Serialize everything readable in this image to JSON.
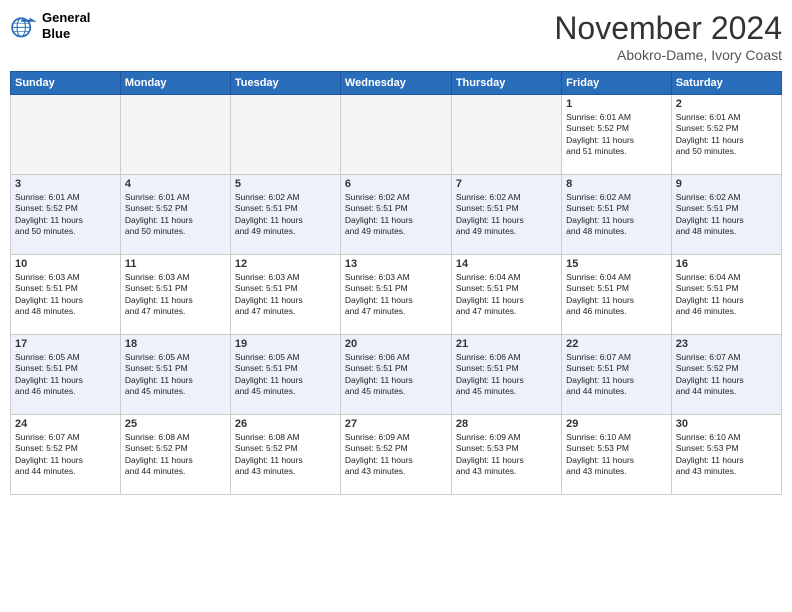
{
  "header": {
    "logo": {
      "line1": "General",
      "line2": "Blue"
    },
    "title": "November 2024",
    "location": "Abokro-Dame, Ivory Coast"
  },
  "weekdays": [
    "Sunday",
    "Monday",
    "Tuesday",
    "Wednesday",
    "Thursday",
    "Friday",
    "Saturday"
  ],
  "weeks": [
    [
      {
        "day": null,
        "info": ""
      },
      {
        "day": null,
        "info": ""
      },
      {
        "day": null,
        "info": ""
      },
      {
        "day": null,
        "info": ""
      },
      {
        "day": null,
        "info": ""
      },
      {
        "day": 1,
        "info": "Sunrise: 6:01 AM\nSunset: 5:52 PM\nDaylight: 11 hours\nand 51 minutes."
      },
      {
        "day": 2,
        "info": "Sunrise: 6:01 AM\nSunset: 5:52 PM\nDaylight: 11 hours\nand 50 minutes."
      }
    ],
    [
      {
        "day": 3,
        "info": "Sunrise: 6:01 AM\nSunset: 5:52 PM\nDaylight: 11 hours\nand 50 minutes."
      },
      {
        "day": 4,
        "info": "Sunrise: 6:01 AM\nSunset: 5:52 PM\nDaylight: 11 hours\nand 50 minutes."
      },
      {
        "day": 5,
        "info": "Sunrise: 6:02 AM\nSunset: 5:51 PM\nDaylight: 11 hours\nand 49 minutes."
      },
      {
        "day": 6,
        "info": "Sunrise: 6:02 AM\nSunset: 5:51 PM\nDaylight: 11 hours\nand 49 minutes."
      },
      {
        "day": 7,
        "info": "Sunrise: 6:02 AM\nSunset: 5:51 PM\nDaylight: 11 hours\nand 49 minutes."
      },
      {
        "day": 8,
        "info": "Sunrise: 6:02 AM\nSunset: 5:51 PM\nDaylight: 11 hours\nand 48 minutes."
      },
      {
        "day": 9,
        "info": "Sunrise: 6:02 AM\nSunset: 5:51 PM\nDaylight: 11 hours\nand 48 minutes."
      }
    ],
    [
      {
        "day": 10,
        "info": "Sunrise: 6:03 AM\nSunset: 5:51 PM\nDaylight: 11 hours\nand 48 minutes."
      },
      {
        "day": 11,
        "info": "Sunrise: 6:03 AM\nSunset: 5:51 PM\nDaylight: 11 hours\nand 47 minutes."
      },
      {
        "day": 12,
        "info": "Sunrise: 6:03 AM\nSunset: 5:51 PM\nDaylight: 11 hours\nand 47 minutes."
      },
      {
        "day": 13,
        "info": "Sunrise: 6:03 AM\nSunset: 5:51 PM\nDaylight: 11 hours\nand 47 minutes."
      },
      {
        "day": 14,
        "info": "Sunrise: 6:04 AM\nSunset: 5:51 PM\nDaylight: 11 hours\nand 47 minutes."
      },
      {
        "day": 15,
        "info": "Sunrise: 6:04 AM\nSunset: 5:51 PM\nDaylight: 11 hours\nand 46 minutes."
      },
      {
        "day": 16,
        "info": "Sunrise: 6:04 AM\nSunset: 5:51 PM\nDaylight: 11 hours\nand 46 minutes."
      }
    ],
    [
      {
        "day": 17,
        "info": "Sunrise: 6:05 AM\nSunset: 5:51 PM\nDaylight: 11 hours\nand 46 minutes."
      },
      {
        "day": 18,
        "info": "Sunrise: 6:05 AM\nSunset: 5:51 PM\nDaylight: 11 hours\nand 45 minutes."
      },
      {
        "day": 19,
        "info": "Sunrise: 6:05 AM\nSunset: 5:51 PM\nDaylight: 11 hours\nand 45 minutes."
      },
      {
        "day": 20,
        "info": "Sunrise: 6:06 AM\nSunset: 5:51 PM\nDaylight: 11 hours\nand 45 minutes."
      },
      {
        "day": 21,
        "info": "Sunrise: 6:06 AM\nSunset: 5:51 PM\nDaylight: 11 hours\nand 45 minutes."
      },
      {
        "day": 22,
        "info": "Sunrise: 6:07 AM\nSunset: 5:51 PM\nDaylight: 11 hours\nand 44 minutes."
      },
      {
        "day": 23,
        "info": "Sunrise: 6:07 AM\nSunset: 5:52 PM\nDaylight: 11 hours\nand 44 minutes."
      }
    ],
    [
      {
        "day": 24,
        "info": "Sunrise: 6:07 AM\nSunset: 5:52 PM\nDaylight: 11 hours\nand 44 minutes."
      },
      {
        "day": 25,
        "info": "Sunrise: 6:08 AM\nSunset: 5:52 PM\nDaylight: 11 hours\nand 44 minutes."
      },
      {
        "day": 26,
        "info": "Sunrise: 6:08 AM\nSunset: 5:52 PM\nDaylight: 11 hours\nand 43 minutes."
      },
      {
        "day": 27,
        "info": "Sunrise: 6:09 AM\nSunset: 5:52 PM\nDaylight: 11 hours\nand 43 minutes."
      },
      {
        "day": 28,
        "info": "Sunrise: 6:09 AM\nSunset: 5:53 PM\nDaylight: 11 hours\nand 43 minutes."
      },
      {
        "day": 29,
        "info": "Sunrise: 6:10 AM\nSunset: 5:53 PM\nDaylight: 11 hours\nand 43 minutes."
      },
      {
        "day": 30,
        "info": "Sunrise: 6:10 AM\nSunset: 5:53 PM\nDaylight: 11 hours\nand 43 minutes."
      }
    ]
  ]
}
